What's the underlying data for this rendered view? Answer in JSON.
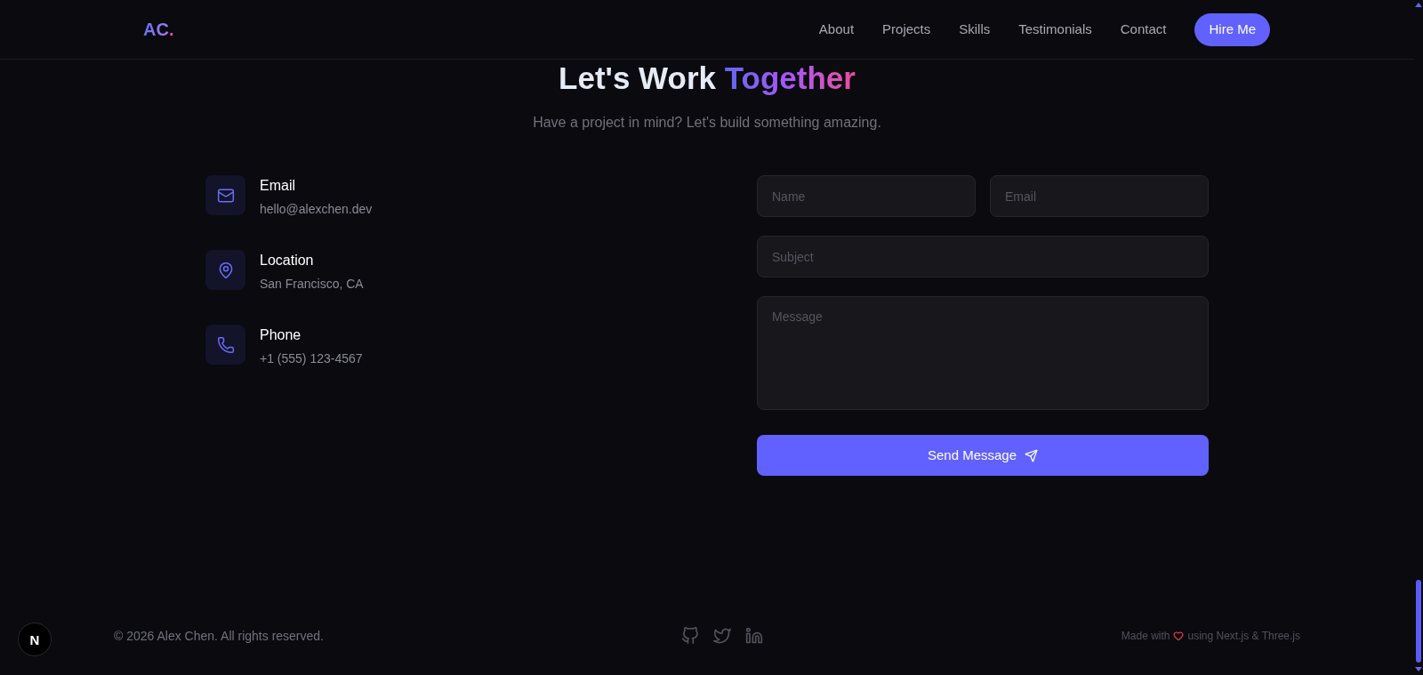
{
  "nav": {
    "logo": {
      "text": "AC",
      "accent": "."
    },
    "links": [
      "About",
      "Projects",
      "Skills",
      "Testimonials",
      "Contact"
    ],
    "cta": "Hire Me"
  },
  "contact": {
    "title": "Let's Work",
    "title_highlight": "Together",
    "subtitle": "Have a project in mind? Let's build something amazing.",
    "info": [
      {
        "kind": "email",
        "label": "Email",
        "value": "hello@alexchen.dev"
      },
      {
        "kind": "location",
        "label": "Location",
        "value": "San Francisco, CA"
      },
      {
        "kind": "phone",
        "label": "Phone",
        "value": "+1 (555) 123-4567"
      }
    ],
    "form": {
      "rows": [
        [
          {
            "kind": "input",
            "placeholder": "Name"
          },
          {
            "kind": "input",
            "placeholder": "Email"
          }
        ],
        [
          {
            "kind": "input",
            "placeholder": "Subject"
          }
        ],
        [
          {
            "kind": "textarea",
            "placeholder": "Message"
          }
        ]
      ],
      "submit": "Send Message"
    }
  },
  "footer": {
    "copyright": "© 2026 Alex Chen. All rights reserved.",
    "social": [
      {
        "kind": "github"
      },
      {
        "kind": "twitter"
      },
      {
        "kind": "linkedin"
      }
    ],
    "credit": {
      "before": "Made with",
      "after": "using Next.js & Three.js"
    }
  },
  "dev_indicator": {
    "label": "N"
  }
}
